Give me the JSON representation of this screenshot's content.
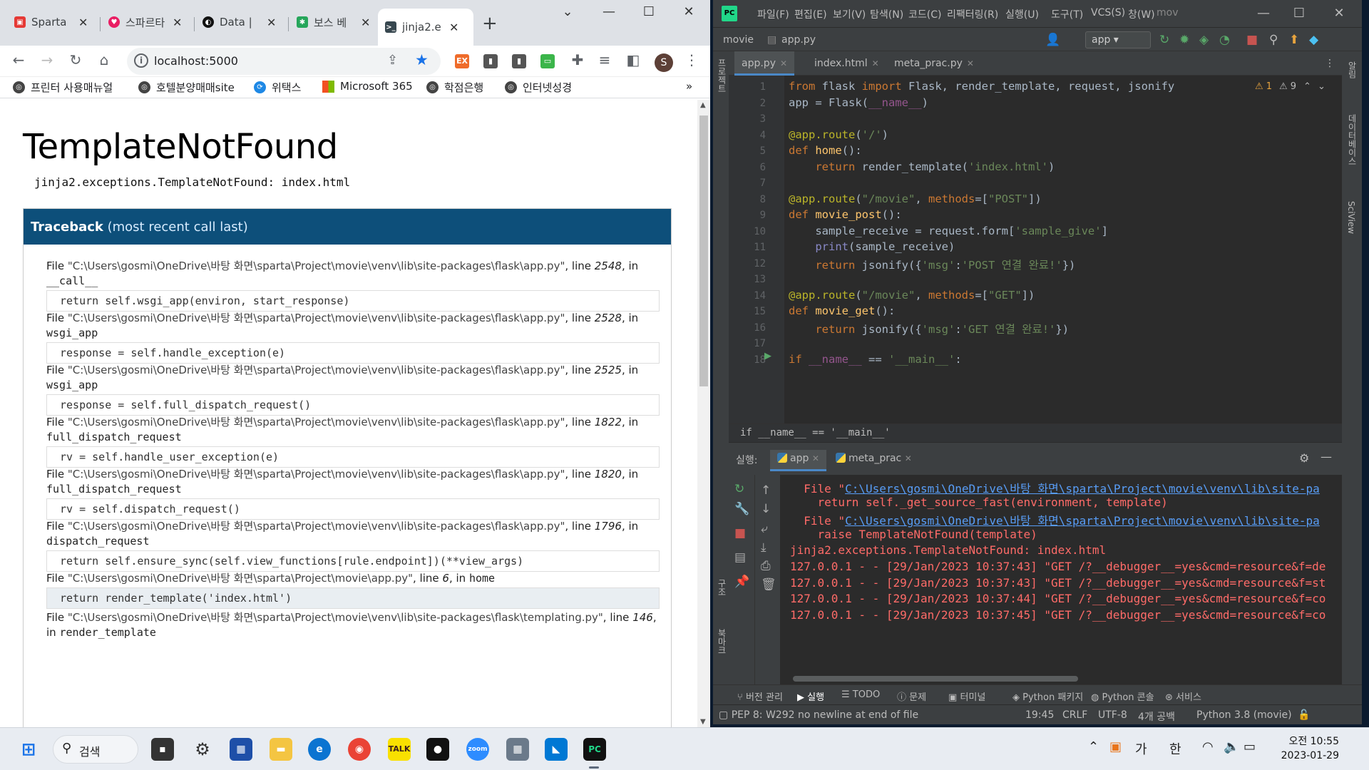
{
  "chrome": {
    "tabs": [
      {
        "label": "Sparta",
        "favicon_color": "#e53935"
      },
      {
        "label": "스파르타",
        "favicon_color": "#e91e63"
      },
      {
        "label": "Data |",
        "favicon_color": "#111111"
      },
      {
        "label": "보스 베",
        "favicon_color": "#26a65b"
      },
      {
        "label": "jinja2.e",
        "favicon_color": "#37474f",
        "active": true
      }
    ],
    "new_tab": "+",
    "window_controls": [
      "⌄",
      "—",
      "☐",
      "✕"
    ],
    "address": "localhost:5000",
    "bookmarks": [
      "프린터 사용매뉴얼",
      "호텔분양매매site",
      "위택스",
      "Microsoft 365",
      "학점은행",
      "인터넷성경"
    ],
    "bookmarks_more": "»",
    "profile_initial": "S"
  },
  "error_page": {
    "title": "TemplateNotFound",
    "message": "jinja2.exceptions.TemplateNotFound: index.html",
    "traceback_title": "Traceback",
    "traceback_sub": "(most recent call last)",
    "frames": [
      {
        "file": "\"C:\\Users\\gosmi\\OneDrive\\바탕 화면\\sparta\\Project\\movie\\venv\\lib\\site-packages\\flask\\app.py\"",
        "line": "2548",
        "func": "__call__",
        "code": "return self.wsgi_app(environ, start_response)"
      },
      {
        "file": "\"C:\\Users\\gosmi\\OneDrive\\바탕 화면\\sparta\\Project\\movie\\venv\\lib\\site-packages\\flask\\app.py\"",
        "line": "2528",
        "func": "wsgi_app",
        "code": "response = self.handle_exception(e)"
      },
      {
        "file": "\"C:\\Users\\gosmi\\OneDrive\\바탕 화면\\sparta\\Project\\movie\\venv\\lib\\site-packages\\flask\\app.py\"",
        "line": "2525",
        "func": "wsgi_app",
        "code": "response = self.full_dispatch_request()"
      },
      {
        "file": "\"C:\\Users\\gosmi\\OneDrive\\바탕 화면\\sparta\\Project\\movie\\venv\\lib\\site-packages\\flask\\app.py\"",
        "line": "1822",
        "func": "full_dispatch_request",
        "code": "rv = self.handle_user_exception(e)"
      },
      {
        "file": "\"C:\\Users\\gosmi\\OneDrive\\바탕 화면\\sparta\\Project\\movie\\venv\\lib\\site-packages\\flask\\app.py\"",
        "line": "1820",
        "func": "full_dispatch_request",
        "code": "rv = self.dispatch_request()"
      },
      {
        "file": "\"C:\\Users\\gosmi\\OneDrive\\바탕 화면\\sparta\\Project\\movie\\venv\\lib\\site-packages\\flask\\app.py\"",
        "line": "1796",
        "func": "dispatch_request",
        "code": "return self.ensure_sync(self.view_functions[rule.endpoint])(**view_args)"
      },
      {
        "file": "\"C:\\Users\\gosmi\\OneDrive\\바탕 화면\\sparta\\Project\\movie\\app.py\"",
        "line": "6",
        "func": "home",
        "code": "return render_template('index.html')",
        "current": true
      },
      {
        "file": "\"C:\\Users\\gosmi\\OneDrive\\바탕 화면\\sparta\\Project\\movie\\venv\\lib\\site-packages\\flask\\templating.py\"",
        "line": "146",
        "func": "render_template",
        "code": ""
      }
    ],
    "labels": {
      "file": "File",
      "line": "line",
      "in": "in"
    }
  },
  "pycharm": {
    "menu": [
      "파일(F)",
      "편집(E)",
      "보기(V)",
      "탐색(N)",
      "코드(C)",
      "리팩터링(R)",
      "실행(U)",
      "도구(T)",
      "VCS(S)",
      "창(W)",
      "mov"
    ],
    "breadcrumb": [
      "movie",
      "app.py"
    ],
    "run_config": "app",
    "editor_tabs": [
      "app.py",
      "index.html",
      "meta_prac.py"
    ],
    "warnings": {
      "errors": "1",
      "warnings": "9"
    },
    "code_lines": [
      {
        "n": "1",
        "html": "<span class='kw'>from</span> flask <span class='kw'>import</span> Flask, render_template, request, jsonify"
      },
      {
        "n": "2",
        "html": "app = Flask(<span class='sf'>__name__</span>)"
      },
      {
        "n": "3",
        "html": ""
      },
      {
        "n": "4",
        "html": "<span class='dc'>@app.route</span>(<span class='st'>'/'</span>)"
      },
      {
        "n": "5",
        "html": "<span class='kw'>def</span> <span class='fn'>home</span>():"
      },
      {
        "n": "6",
        "html": "    <span class='kw'>return</span> render_template(<span class='st'>'index.html'</span>)"
      },
      {
        "n": "7",
        "html": ""
      },
      {
        "n": "8",
        "html": "<span class='dc'>@app.route</span>(<span class='st'>\"/movie\"</span>, <span class='kw'>methods</span>=[<span class='st'>\"POST\"</span>])"
      },
      {
        "n": "9",
        "html": "<span class='kw'>def</span> <span class='fn'>movie_post</span>():"
      },
      {
        "n": "10",
        "html": "    sample_receive = request.form[<span class='st'>'sample_give'</span>]"
      },
      {
        "n": "11",
        "html": "    <span class='bi'>print</span>(sample_receive)"
      },
      {
        "n": "12",
        "html": "    <span class='kw'>return</span> jsonify({<span class='st'>'msg'</span>:<span class='st'>'POST 연결 완료!'</span>})"
      },
      {
        "n": "13",
        "html": ""
      },
      {
        "n": "14",
        "html": "<span class='dc'>@app.route</span>(<span class='st'>\"/movie\"</span>, <span class='kw'>methods</span>=[<span class='st'>\"GET\"</span>])"
      },
      {
        "n": "15",
        "html": "<span class='kw'>def</span> <span class='fn'>movie_get</span>():"
      },
      {
        "n": "16",
        "html": "    <span class='kw'>return</span> jsonify({<span class='st'>'msg'</span>:<span class='st'>'GET 연결 완료!'</span>})"
      },
      {
        "n": "17",
        "html": ""
      },
      {
        "n": "18",
        "html": "<span class='kw'>if</span> <span class='sf'>__name__</span> == <span class='st'>'__main__'</span>:"
      }
    ],
    "code_breadcrumb": "if __name__ == '__main__'",
    "run_label": "실행:",
    "run_tabs": [
      "app",
      "meta_prac"
    ],
    "console": [
      {
        "pre": "  File \"",
        "link": "C:\\Users\\gosmi\\OneDrive\\바탕 화면\\sparta\\Project\\movie\\venv\\lib\\site-pa",
        "post": ""
      },
      {
        "pre": "    return self._get_source_fast(environment, template)",
        "link": "",
        "post": ""
      },
      {
        "pre": "  File \"",
        "link": "C:\\Users\\gosmi\\OneDrive\\바탕 화면\\sparta\\Project\\movie\\venv\\lib\\site-pa",
        "post": ""
      },
      {
        "pre": "    raise TemplateNotFound(template)",
        "link": "",
        "post": ""
      },
      {
        "pre": "jinja2.exceptions.TemplateNotFound: index.html",
        "link": "",
        "post": ""
      },
      {
        "pre": "127.0.0.1 - - [29/Jan/2023 10:37:43] \"GET /?__debugger__=yes&cmd=resource&f=de",
        "link": "",
        "post": ""
      },
      {
        "pre": "127.0.0.1 - - [29/Jan/2023 10:37:43] \"GET /?__debugger__=yes&cmd=resource&f=st",
        "link": "",
        "post": ""
      },
      {
        "pre": "127.0.0.1 - - [29/Jan/2023 10:37:44] \"GET /?__debugger__=yes&cmd=resource&f=co",
        "link": "",
        "post": ""
      },
      {
        "pre": "127.0.0.1 - - [29/Jan/2023 10:37:45] \"GET /?__debugger__=yes&cmd=resource&f=co",
        "link": "",
        "post": ""
      }
    ],
    "bottom_tools": [
      "버전 관리",
      "실행",
      "TODO",
      "문제",
      "터미널",
      "Python 패키지",
      "Python 콘솔",
      "서비스"
    ],
    "status": {
      "message": "PEP 8: W292 no newline at end of file",
      "position": "19:45",
      "line_sep": "CRLF",
      "encoding": "UTF-8",
      "indent": "4개 공백",
      "interpreter": "Python 3.8 (movie)"
    },
    "left_strip": [
      "프로젝트",
      "구조",
      "북마크"
    ],
    "right_strip": [
      "알림",
      "데이터베이스",
      "SciView"
    ]
  },
  "taskbar": {
    "search": "검색",
    "tray_ime": [
      "가",
      "한"
    ],
    "time": "오전 10:55",
    "date": "2023-01-29"
  }
}
